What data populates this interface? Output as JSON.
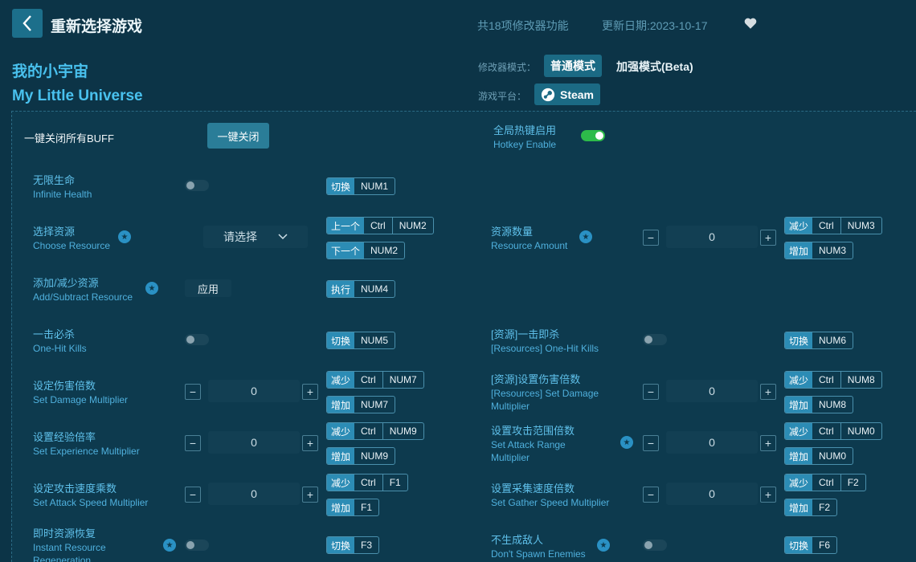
{
  "header": {
    "title": "重新选择游戏",
    "features_count": "共18项修改器功能",
    "update_date": "更新日期:2023-10-17"
  },
  "game": {
    "name_cn": "我的小宇宙",
    "name_en": "My Little Universe"
  },
  "mode": {
    "label": "修改器模式：",
    "normal": "普通模式",
    "beta": "加强模式(Beta)"
  },
  "platform": {
    "label": "游戏平台：",
    "name": "Steam"
  },
  "top": {
    "close_all_label": "一键关闭所有BUFF",
    "close_all_button": "一键关闭",
    "hotkey_cn": "全局热键启用",
    "hotkey_en": "Hotkey Enable",
    "hotkey_enabled": true
  },
  "common": {
    "toggle": "切换",
    "prev": "上一个",
    "next": "下一个",
    "exec": "执行",
    "decrease": "减少",
    "increase": "增加",
    "select_placeholder": "请选择",
    "apply": "应用",
    "zero": "0",
    "minus": "−",
    "plus": "+"
  },
  "keys": {
    "num0": "NUM0",
    "num1": "NUM1",
    "num2": "NUM2",
    "num3": "NUM3",
    "num4": "NUM4",
    "num5": "NUM5",
    "num6": "NUM6",
    "num7": "NUM7",
    "num8": "NUM8",
    "num9": "NUM9",
    "ctrl": "Ctrl",
    "f1": "F1",
    "f2": "F2",
    "f3": "F3",
    "f6": "F6"
  },
  "features": {
    "infinite_health": {
      "cn": "无限生命",
      "en": "Infinite Health"
    },
    "choose_resource": {
      "cn": "选择资源",
      "en": "Choose Resource"
    },
    "resource_amount": {
      "cn": "资源数量",
      "en": "Resource Amount"
    },
    "add_sub_resource": {
      "cn": "添加/减少资源",
      "en": "Add/Subtract Resource"
    },
    "one_hit": {
      "cn": "一击必杀",
      "en": "One-Hit Kills"
    },
    "res_one_hit": {
      "cn": "[资源]一击即杀",
      "en": "[Resources] One-Hit Kills"
    },
    "damage_mult": {
      "cn": "设定伤害倍数",
      "en": "Set Damage Multiplier"
    },
    "res_damage_mult": {
      "cn": "[资源]设置伤害倍数",
      "en1": "[Resources] Set Damage",
      "en2": "Multiplier"
    },
    "exp_mult": {
      "cn": "设置经验倍率",
      "en": "Set Experience Multiplier"
    },
    "attack_range": {
      "cn": "设置攻击范围倍数",
      "en1": "Set Attack Range",
      "en2": "Multiplier"
    },
    "attack_speed": {
      "cn": "设定攻击速度乘数",
      "en": "Set Attack Speed Multiplier"
    },
    "gather_speed": {
      "cn": "设置采集速度倍数",
      "en": "Set Gather Speed Multiplier"
    },
    "instant_regen": {
      "cn": "即时资源恢复",
      "en1": "Instant Resource",
      "en2": "Regeneration"
    },
    "no_spawn": {
      "cn": "不生成敌人",
      "en": "Don't Spawn Enemies"
    }
  }
}
